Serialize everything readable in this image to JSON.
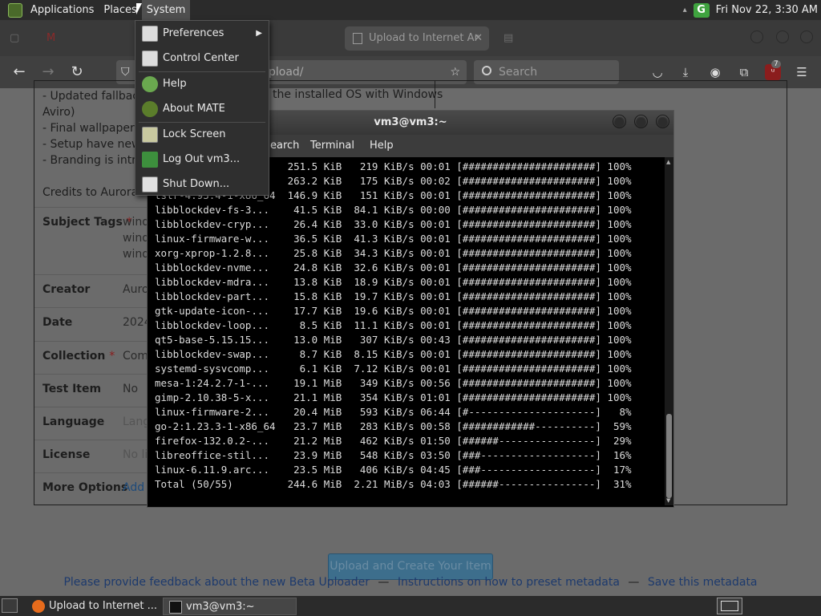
{
  "top_panel": {
    "menus": [
      "Applications",
      "Places",
      "System"
    ],
    "clock": "Fri Nov 22,  3:30 AM"
  },
  "browser": {
    "tab_title": "Upload to Internet Ar",
    "url": "pload/",
    "search_placeholder": "Search",
    "ublock_count": "7"
  },
  "form": {
    "description_lines": [
      "- Updated fallback",
      "Aviro)",
      "- Final wallpaper is",
      "- Setup have new c",
      "- Branding is introd",
      "",
      "Credits to Aurorari"
    ],
    "description_right": "the installed OS with Windows",
    "fields": [
      {
        "label": "Subject Tags",
        "required": true,
        "value": "wind",
        "extra": [
          "wind",
          "wind"
        ]
      },
      {
        "label": "Creator",
        "required": false,
        "value": "Auro"
      },
      {
        "label": "Date",
        "required": false,
        "value": "2024"
      },
      {
        "label": "Collection",
        "required": true,
        "value": "Com"
      },
      {
        "label": "Test Item",
        "required": false,
        "value": "No"
      },
      {
        "label": "Language",
        "required": false,
        "value": "Lang"
      },
      {
        "label": "License",
        "required": false,
        "value": "No li"
      },
      {
        "label": "More Options",
        "required": false,
        "value": "Add"
      }
    ],
    "upload_button": "Upload and Create Your Item",
    "footer_links": [
      "Please provide feedback about the new Beta Uploader",
      "Instructions on how to preset metadata",
      "Save this metadata"
    ],
    "footer_sep": "—"
  },
  "terminal": {
    "title": "vm3@vm3:~",
    "menus": [
      "earch",
      "Terminal",
      "Help"
    ],
    "lines": [
      "                  .   251.5 KiB   219 KiB/s 00:01 [######################] 100%",
      "                  .   263.2 KiB   175 KiB/s 00:02 [######################] 100%",
      "tslr-4.93.4-1-x86_64  146.9 KiB   151 KiB/s 00:01 [######################] 100%",
      "libblockdev-fs-3...    41.5 KiB  84.1 KiB/s 00:00 [######################] 100%",
      "libblockdev-cryp...    26.4 KiB  33.0 KiB/s 00:01 [######################] 100%",
      "linux-firmware-w...    36.5 KiB  41.3 KiB/s 00:01 [######################] 100%",
      "xorg-xprop-1.2.8...    25.8 KiB  34.3 KiB/s 00:01 [######################] 100%",
      "libblockdev-nvme...    24.8 KiB  32.6 KiB/s 00:01 [######################] 100%",
      "libblockdev-mdra...    13.8 KiB  18.9 KiB/s 00:01 [######################] 100%",
      "libblockdev-part...    15.8 KiB  19.7 KiB/s 00:01 [######################] 100%",
      "gtk-update-icon-...    17.7 KiB  19.6 KiB/s 00:01 [######################] 100%",
      "libblockdev-loop...     8.5 KiB  11.1 KiB/s 00:01 [######################] 100%",
      "qt5-base-5.15.15...    13.0 MiB   307 KiB/s 00:43 [######################] 100%",
      "libblockdev-swap...     8.7 KiB  8.15 KiB/s 00:01 [######################] 100%",
      "systemd-sysvcomp...     6.1 KiB  7.12 KiB/s 00:01 [######################] 100%",
      "mesa-1:24.2.7-1-...    19.1 MiB   349 KiB/s 00:56 [######################] 100%",
      "gimp-2.10.38-5-x...    21.1 MiB   354 KiB/s 01:01 [######################] 100%",
      "linux-firmware-2...    20.4 MiB   593 KiB/s 06:44 [#---------------------]   8%",
      "go-2:1.23.3-1-x86_64   23.7 MiB   283 KiB/s 00:58 [############----------]  59%",
      "firefox-132.0.2-...    21.2 MiB   462 KiB/s 01:50 [######----------------]  29%",
      "libreoffice-stil...    23.9 MiB   548 KiB/s 03:50 [###-------------------]  16%",
      "linux-6.11.9.arc...    23.5 MiB   406 KiB/s 04:45 [###-------------------]  17%",
      "Total (50/55)         244.6 MiB  2.21 MiB/s 04:03 [######----------------]  31%"
    ]
  },
  "system_menu": {
    "items": [
      "Preferences",
      "Control Center",
      "Help",
      "About MATE",
      "Lock Screen",
      "Log Out vm3...",
      "Shut Down..."
    ],
    "submenu_arrow": "▶"
  },
  "bottom_panel": {
    "tasks": [
      "Upload to Internet ...",
      "vm3@vm3:~"
    ]
  }
}
